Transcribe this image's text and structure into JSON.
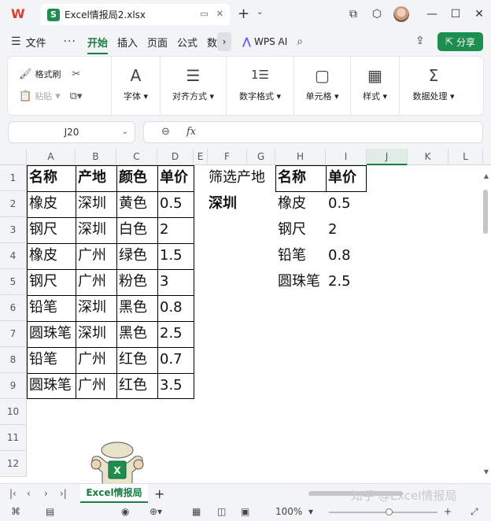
{
  "app": {
    "logo": "W",
    "tab_title": "Excel情报局2.xlsx",
    "tab_icon_letter": "S"
  },
  "menu": {
    "file": "文件",
    "more": "···",
    "tabs": [
      "开始",
      "插入",
      "页面",
      "公式",
      "数"
    ],
    "wps_ai": "WPS AI",
    "share": "分享"
  },
  "ribbon": {
    "format_painter": "格式刷",
    "paste": "粘贴",
    "groups": [
      {
        "label": "字体 ▾",
        "icon": "A"
      },
      {
        "label": "对齐方式 ▾",
        "icon": "☰"
      },
      {
        "label": "数字格式 ▾",
        "icon": "1☰"
      },
      {
        "label": "单元格 ▾",
        "icon": "▢"
      },
      {
        "label": "样式 ▾",
        "icon": "▦"
      },
      {
        "label": "数据处理 ▾",
        "icon": "Σ"
      }
    ]
  },
  "formula_bar": {
    "name_box": "J20",
    "fx": "fx",
    "value": ""
  },
  "columns": [
    "A",
    "B",
    "C",
    "D",
    "E",
    "F",
    "G",
    "H",
    "I",
    "J",
    "K",
    "L"
  ],
  "selected_column": "J",
  "rows": [
    "1",
    "2",
    "3",
    "4",
    "5",
    "6",
    "7",
    "8",
    "9",
    "10",
    "11",
    "12"
  ],
  "table": {
    "headers": [
      "名称",
      "产地",
      "颜色",
      "单价"
    ],
    "rows": [
      [
        "橡皮",
        "深圳",
        "黄色",
        "0.5"
      ],
      [
        "钢尺",
        "深圳",
        "白色",
        "2"
      ],
      [
        "橡皮",
        "广州",
        "绿色",
        "1.5"
      ],
      [
        "钢尺",
        "广州",
        "粉色",
        "3"
      ],
      [
        "铅笔",
        "深圳",
        "黑色",
        "0.8"
      ],
      [
        "圆珠笔",
        "深圳",
        "黑色",
        "2.5"
      ],
      [
        "铅笔",
        "广州",
        "红色",
        "0.7"
      ],
      [
        "圆珠笔",
        "广州",
        "红色",
        "3.5"
      ]
    ]
  },
  "filter": {
    "label": "筛选产地",
    "value": "深圳"
  },
  "result": {
    "headers": [
      "名称",
      "单价"
    ],
    "rows": [
      [
        "橡皮",
        "0.5"
      ],
      [
        "钢尺",
        "2"
      ],
      [
        "铅笔",
        "0.8"
      ],
      [
        "圆珠笔",
        "2.5"
      ]
    ]
  },
  "sheet_tabs": {
    "active": "Excel情报局"
  },
  "watermark": "知乎 @Excel情报局",
  "status": {
    "zoom": "100%",
    "zoom_level": 0.55
  },
  "colors": {
    "accent": "#1a7d44",
    "share_button": "#1e8e4e",
    "wps_logo": "#e03a2f"
  }
}
